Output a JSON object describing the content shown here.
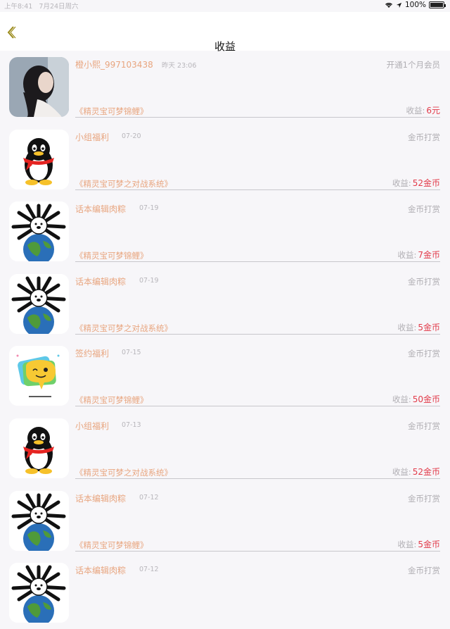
{
  "status": {
    "time": "上午8:41",
    "date": "7月24日周六",
    "battery": "100%",
    "battery_level": 1.0
  },
  "nav": {
    "title": "收益",
    "back_icon": "chevron-left-icon"
  },
  "colors": {
    "accent": "#e8a57f",
    "amount": "#e23b4a",
    "muted": "#b0aeb3"
  },
  "income_label": "收益:",
  "rows": [
    {
      "avatar": "photo-avatar",
      "name": "橙小熙_997103438",
      "time": "昨天 23:06",
      "type": "开通1个月会员",
      "story": "《精灵宝可梦锦鲤》",
      "amount": "6元"
    },
    {
      "avatar": "penguin-avatar",
      "name": "小组福利",
      "time": "07-20",
      "type": "金币打赏",
      "story": "《精灵宝可梦之对战系统》",
      "amount": "52金币"
    },
    {
      "avatar": "globe-avatar",
      "name": "话本编辑肉粽",
      "time": "07-19",
      "type": "金币打赏",
      "story": "《精灵宝可梦锦鲤》",
      "amount": "7金币"
    },
    {
      "avatar": "globe-avatar",
      "name": "话本编辑肉粽",
      "time": "07-19",
      "type": "金币打赏",
      "story": "《精灵宝可梦之对战系统》",
      "amount": "5金币"
    },
    {
      "avatar": "chat-avatar",
      "name": "签约福利",
      "time": "07-15",
      "type": "金币打赏",
      "story": "《精灵宝可梦锦鲤》",
      "amount": "50金币"
    },
    {
      "avatar": "penguin-avatar",
      "name": "小组福利",
      "time": "07-13",
      "type": "金币打赏",
      "story": "《精灵宝可梦之对战系统》",
      "amount": "52金币"
    },
    {
      "avatar": "globe-avatar",
      "name": "话本编辑肉粽",
      "time": "07-12",
      "type": "金币打赏",
      "story": "《精灵宝可梦锦鲤》",
      "amount": "5金币"
    },
    {
      "avatar": "globe-avatar",
      "name": "话本编辑肉粽",
      "time": "07-12",
      "type": "金币打赏",
      "story": "",
      "amount": ""
    }
  ]
}
